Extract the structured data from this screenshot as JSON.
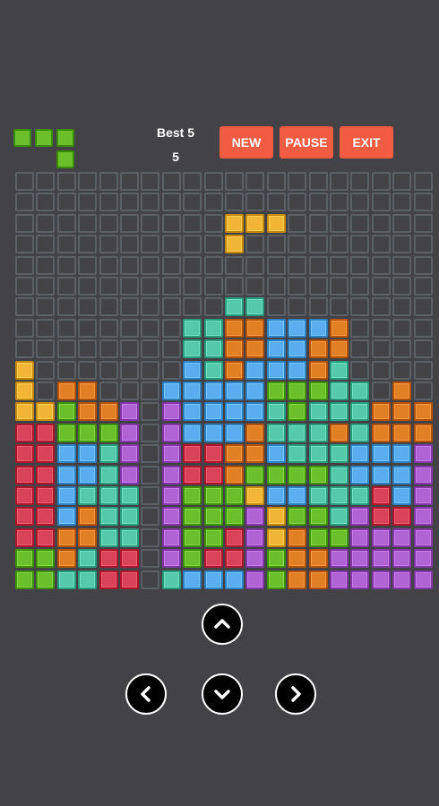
{
  "header": {
    "best_label": "Best 5",
    "score": "5",
    "new_label": "NEW",
    "pause_label": "PAUSE",
    "exit_label": "EXIT"
  },
  "colors": {
    "background": "#434246",
    "empty_cell_border": "#5b6067",
    "button": "#f25c43",
    "G": "#6bbf2b",
    "Y": "#f2b636",
    "O": "#e07f24",
    "T": "#55c9aa",
    "B": "#5aaef0",
    "R": "#d9435a",
    "P": "#b064d4"
  },
  "next_piece": {
    "color": "G",
    "cells": [
      [
        0,
        0
      ],
      [
        1,
        0
      ],
      [
        2,
        0
      ],
      [
        2,
        1
      ]
    ]
  },
  "board": {
    "cols": 20,
    "rows": 20,
    "grid": [
      "....................",
      "....................",
      "..........YYY.......",
      "..........Y.........",
      "....................",
      "....................",
      "..........TT........",
      "........TTOOBBBO....",
      "........TTOOBBOO....",
      "Y.......BTOBBBOT....",
      "Y.OO...BBBBBGGGTT.O.",
      "YYGOOP.PBBBBTGTTTOOO",
      "RRGGGP.PBBBOTTTOTOOO",
      "RRBBTP.PRROOBTTTBBBP",
      "RRBBTP.PRROGGGGTBBBP",
      "RRBTTT.PGGGYBBTTTRBP",
      "RRBOTT.PGGGPYGGTPRRP",
      "RROOTT.PGGRPYOGGPPPP",
      "GGOTRR.PGRRPGOOPPPPP",
      "GGTTRR.TBBBPGOOPPPPP"
    ]
  },
  "controls": {
    "up": "chevron-up-icon",
    "left": "chevron-left-icon",
    "down": "chevron-down-icon",
    "right": "chevron-right-icon"
  }
}
